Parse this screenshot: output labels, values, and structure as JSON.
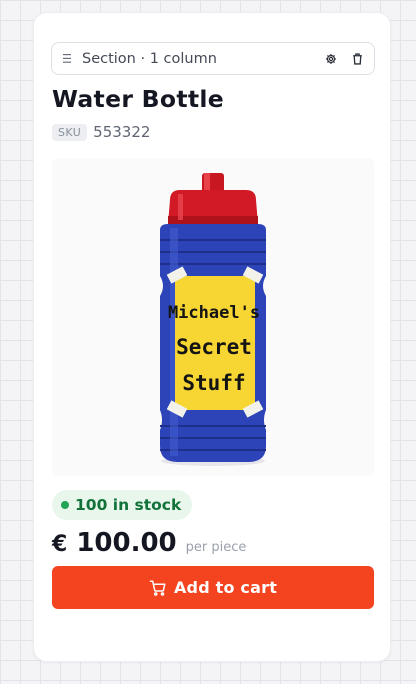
{
  "section": {
    "label": "Section · 1 column"
  },
  "product": {
    "title": "Water Bottle",
    "sku_badge": "SKU",
    "sku_value": "553322",
    "image_label_lines": [
      "Michael's",
      "Secret",
      "Stuff"
    ],
    "stock_text": "100 in stock",
    "currency": "€",
    "price": "100.00",
    "unit": "per piece"
  },
  "cart": {
    "label": "Add to cart"
  },
  "colors": {
    "accent": "#f4441f",
    "stock_green": "#21a454",
    "bottle_blue": "#2c44b8",
    "cap_red": "#d11a25",
    "label_yellow": "#f7d633"
  },
  "icons": [
    "drag-handle-icon",
    "gear-icon",
    "trash-icon",
    "cart-icon"
  ]
}
